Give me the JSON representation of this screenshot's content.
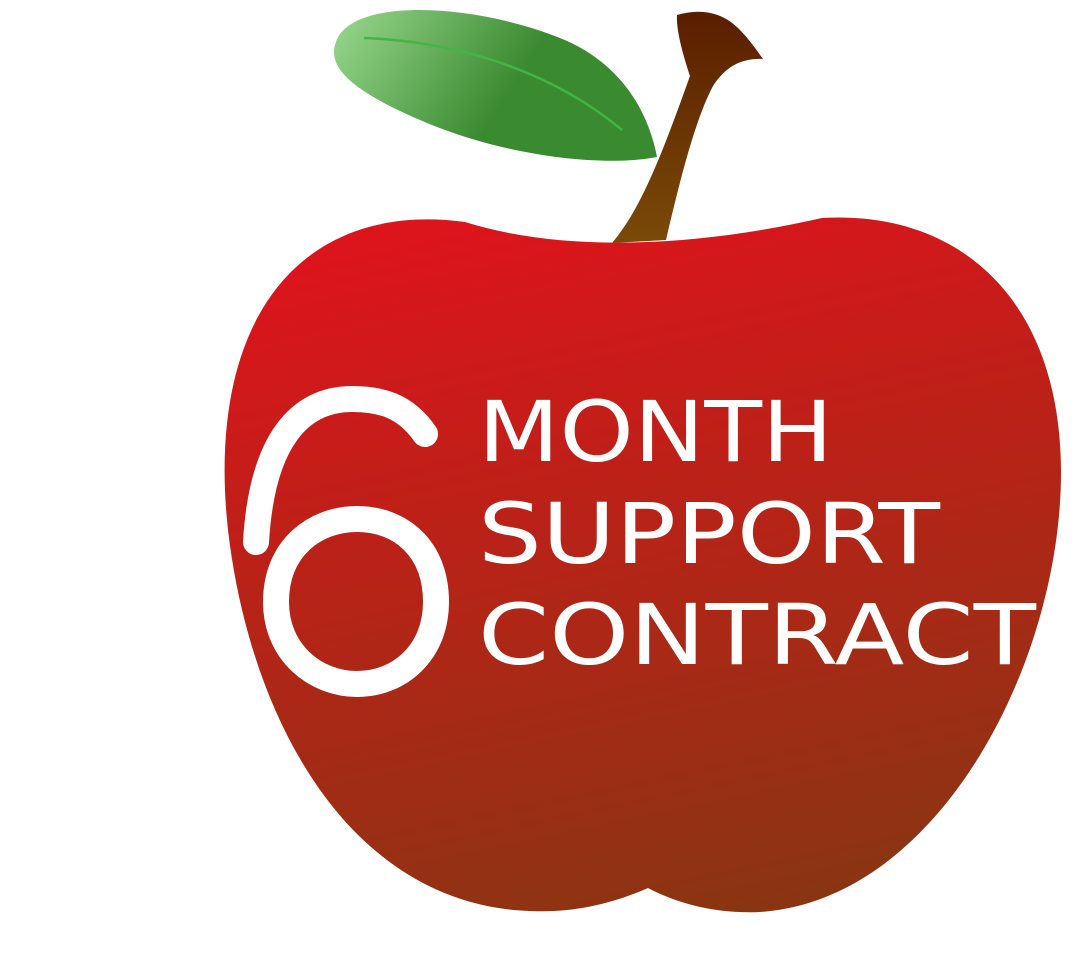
{
  "badge": {
    "number": "6",
    "lines": [
      "MONTH",
      "SUPPORT",
      "CONTRACT"
    ]
  },
  "colors": {
    "apple_top": "#dc141c",
    "apple_bottom": "#8a3512",
    "leaf_light": "#9ad98f",
    "leaf_dark": "#3a8a30",
    "leaf_vein": "#44b544",
    "stem_dark": "#5a1e00",
    "stem_light": "#7a4a08",
    "text": "#ffffff"
  },
  "icons": [
    "apple-icon",
    "leaf-icon",
    "stem-icon"
  ]
}
